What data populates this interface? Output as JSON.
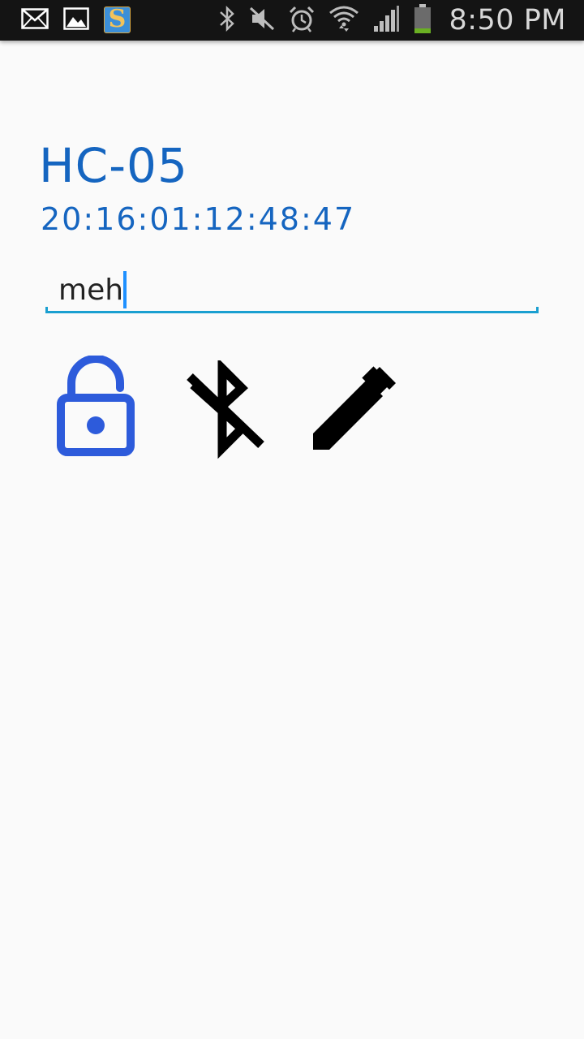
{
  "status_bar": {
    "time": "8:50 PM",
    "left_icons": [
      "email-icon",
      "gallery-icon",
      "app-s-icon"
    ],
    "app_badge_letter": "S",
    "right_icons": [
      "bluetooth-icon",
      "mute-icon",
      "alarm-icon",
      "wifi-icon",
      "signal-icon",
      "battery-icon"
    ]
  },
  "device": {
    "name": "HC-05",
    "address": "20:16:01:12:48:47"
  },
  "edit_field": {
    "value": "meh"
  },
  "actions": [
    {
      "icon": "lock-open-icon",
      "color": "#2d5bdb"
    },
    {
      "icon": "bluetooth-disabled-icon",
      "color": "#000000"
    },
    {
      "icon": "pencil-icon",
      "color": "#000000"
    }
  ],
  "colors": {
    "accent": "#1565c0",
    "field_underline": "#1a9fd0",
    "caret": "#1e90ff",
    "background": "#fafafa",
    "status_bar": "#141414"
  }
}
